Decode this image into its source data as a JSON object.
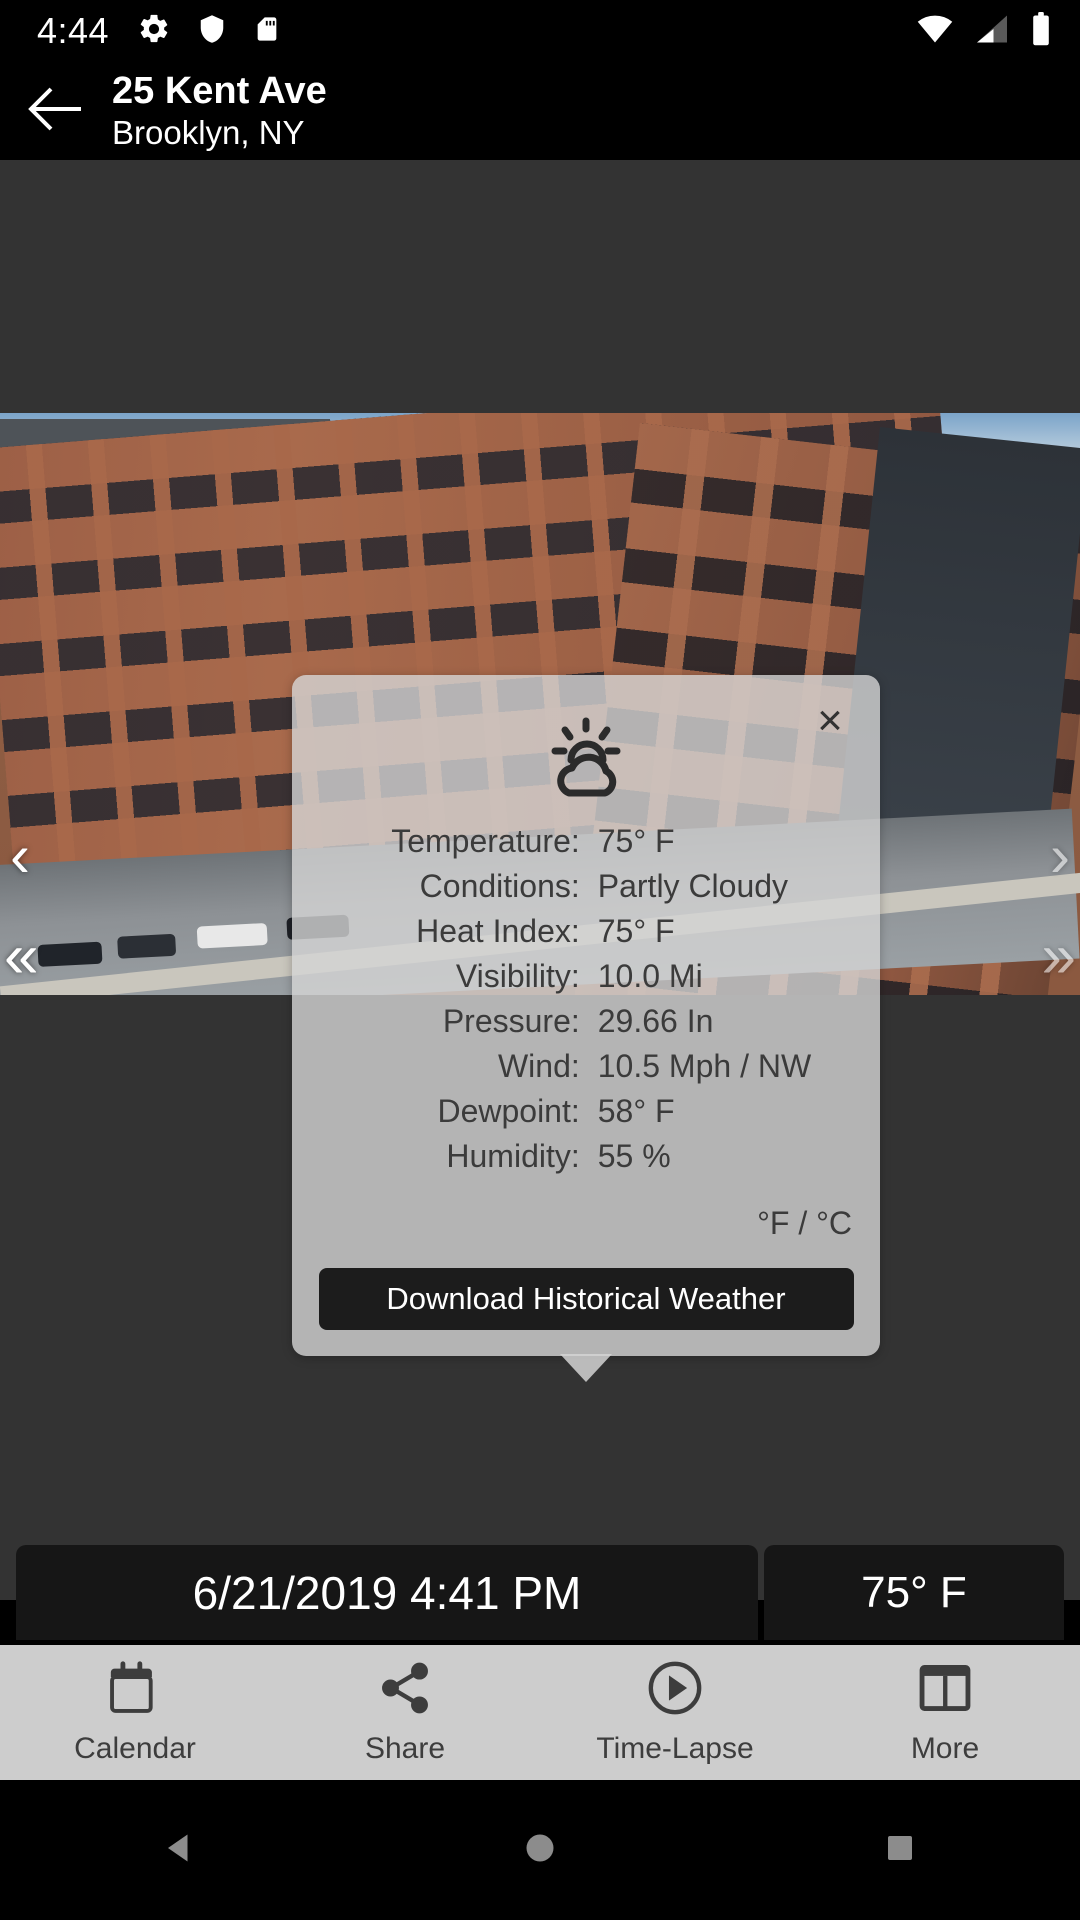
{
  "statusbar": {
    "time": "4:44",
    "left_icons": [
      "gear-icon",
      "shield-icon",
      "sd-card-icon"
    ],
    "right_icons": [
      "wifi-icon",
      "cell-signal-icon",
      "battery-icon"
    ]
  },
  "header": {
    "back_icon": "back-arrow-icon",
    "title": "25 Kent Ave",
    "subtitle": "Brooklyn, NY"
  },
  "viewer": {
    "prev_label": "‹",
    "prev_fast_label": "«",
    "next_label": "›",
    "next_fast_label": "»"
  },
  "popup": {
    "close_label": "×",
    "weather_icon": "partly-cloudy-icon",
    "rows": [
      {
        "label": "Temperature:",
        "value": "75° F"
      },
      {
        "label": "Conditions:",
        "value": "Partly Cloudy"
      },
      {
        "label": "Heat Index:",
        "value": "75° F"
      },
      {
        "label": "Visibility:",
        "value": "10.0 Mi"
      },
      {
        "label": "Pressure:",
        "value": "29.66 In"
      },
      {
        "label": "Wind:",
        "value": "10.5 Mph / NW"
      },
      {
        "label": "Dewpoint:",
        "value": "58° F"
      },
      {
        "label": "Humidity:",
        "value": "55 %"
      }
    ],
    "unit_toggle": "°F / °C",
    "download_button": "Download Historical Weather"
  },
  "infobar": {
    "timestamp": "6/21/2019 4:41 PM",
    "temperature": "75° F"
  },
  "tabbar": {
    "items": [
      {
        "label": "Calendar",
        "icon": "calendar-icon"
      },
      {
        "label": "Share",
        "icon": "share-icon"
      },
      {
        "label": "Time-Lapse",
        "icon": "play-circle-icon"
      },
      {
        "label": "More",
        "icon": "panels-icon"
      }
    ]
  },
  "navbar": {
    "back": "nav-back-icon",
    "home": "nav-home-icon",
    "recents": "nav-recents-icon"
  },
  "colors": {
    "status_bg": "#000000",
    "header_bg": "#000000",
    "viewport_bg": "#333333",
    "popup_bg": "#d4d4d4",
    "accent_dark": "#1c1c1c",
    "tabbar_bg": "#cdcdcd"
  }
}
